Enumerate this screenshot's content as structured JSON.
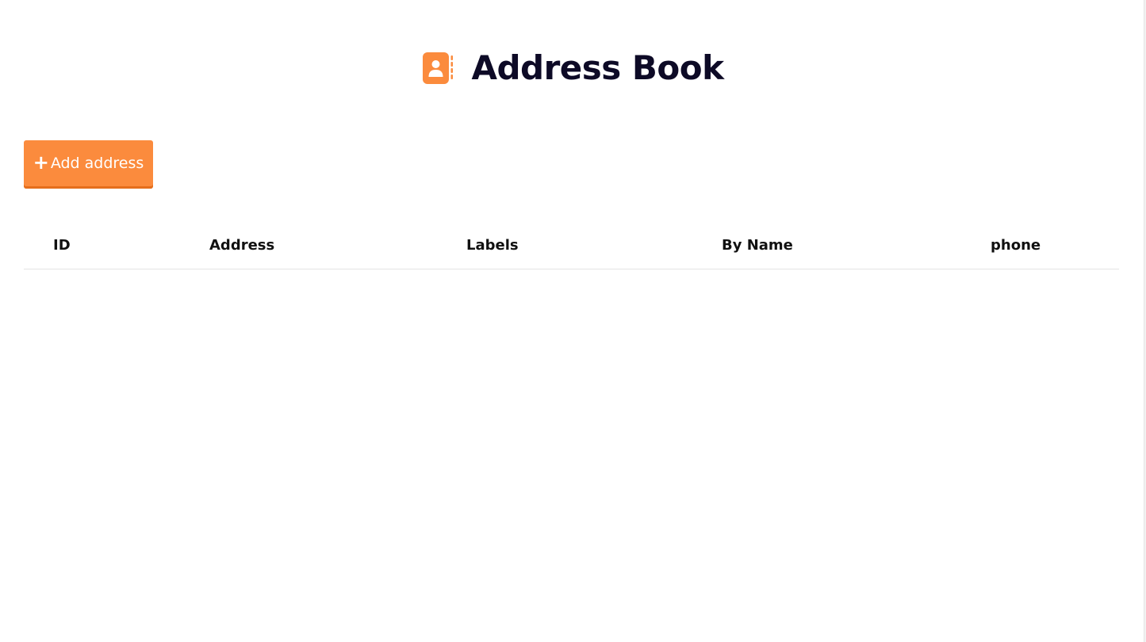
{
  "header": {
    "title": "Address Book",
    "icon": "address-book-icon",
    "accent_color": "#fb8b3d"
  },
  "toolbar": {
    "add_label": "Add address",
    "add_icon": "plus-icon"
  },
  "table": {
    "columns": [
      "ID",
      "Address",
      "Labels",
      "By Name",
      "phone"
    ],
    "rows": []
  }
}
